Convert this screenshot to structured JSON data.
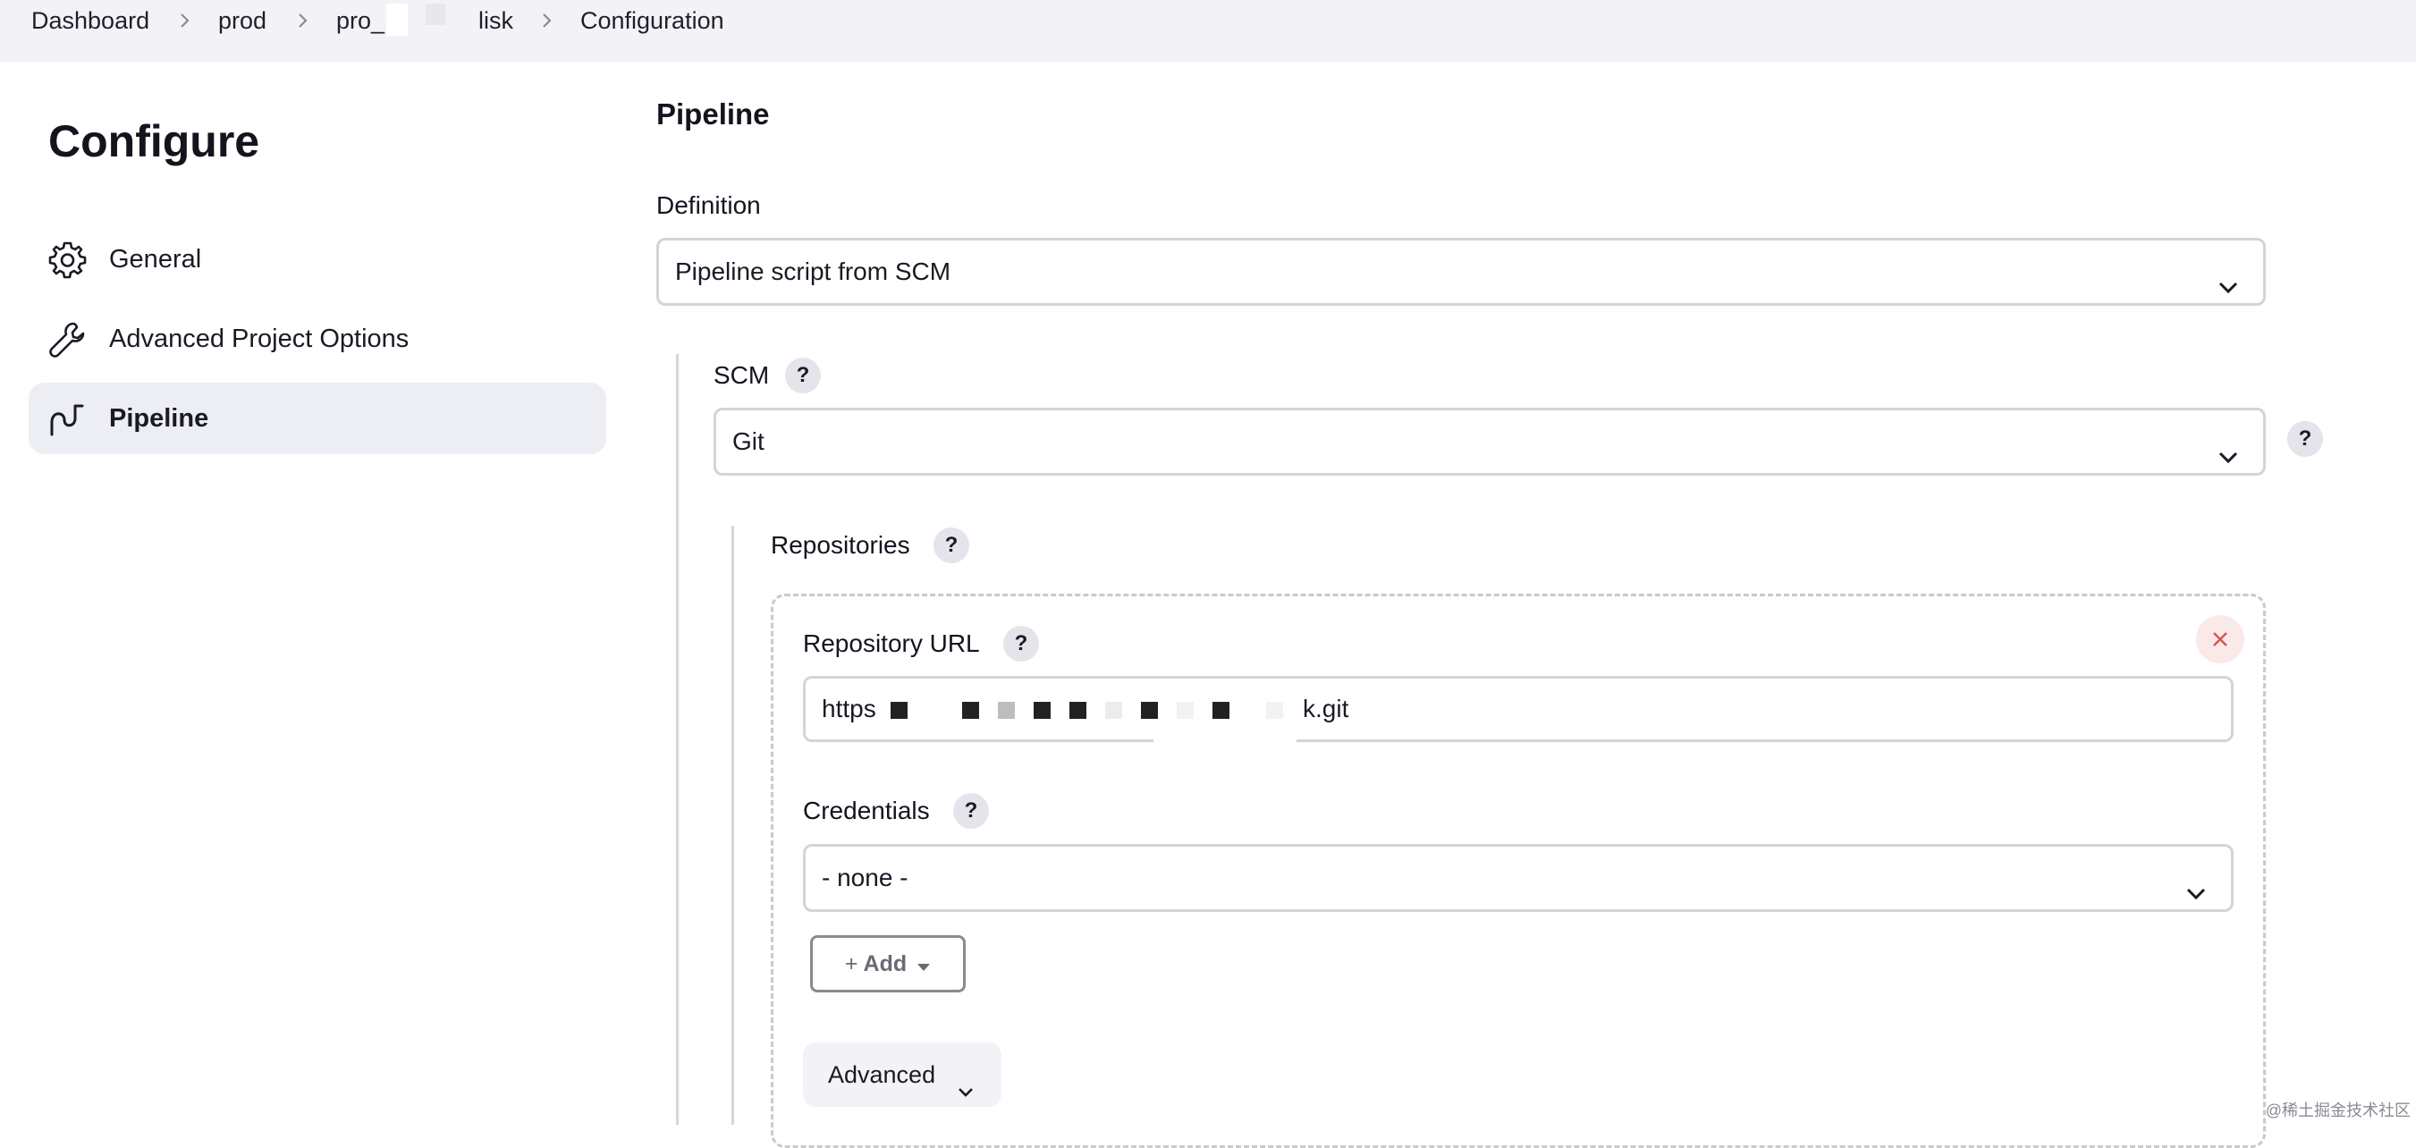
{
  "breadcrumb": {
    "items": [
      "Dashboard",
      "prod",
      "pro_",
      "lisk",
      "Configuration"
    ]
  },
  "sidebar": {
    "title": "Configure",
    "items": [
      {
        "label": "General",
        "icon": "gear-icon"
      },
      {
        "label": "Advanced Project Options",
        "icon": "wrench-icon"
      },
      {
        "label": "Pipeline",
        "icon": "pipeline-icon",
        "active": true
      }
    ]
  },
  "main": {
    "section_title": "Pipeline",
    "definition": {
      "label": "Definition",
      "value": "Pipeline script from SCM"
    },
    "scm": {
      "label": "SCM",
      "value": "Git",
      "help": "?"
    },
    "repositories": {
      "label": "Repositories",
      "help": "?",
      "repository_url": {
        "label": "Repository URL",
        "help": "?",
        "value_prefix": "https",
        "value_suffix": "k.git"
      },
      "credentials": {
        "label": "Credentials",
        "help": "?",
        "value": "- none -"
      },
      "add_button": {
        "label": "Add"
      },
      "advanced_button": {
        "label": "Advanced"
      }
    }
  },
  "watermark": "@稀土掘金技术社区",
  "colors": {
    "breadcrumb_bg": "#f3f3f7",
    "active_item_bg": "#ededf4",
    "border": "#d4d4d8",
    "delete_bg": "#fbe9e9",
    "delete_icon": "#d9534f"
  }
}
